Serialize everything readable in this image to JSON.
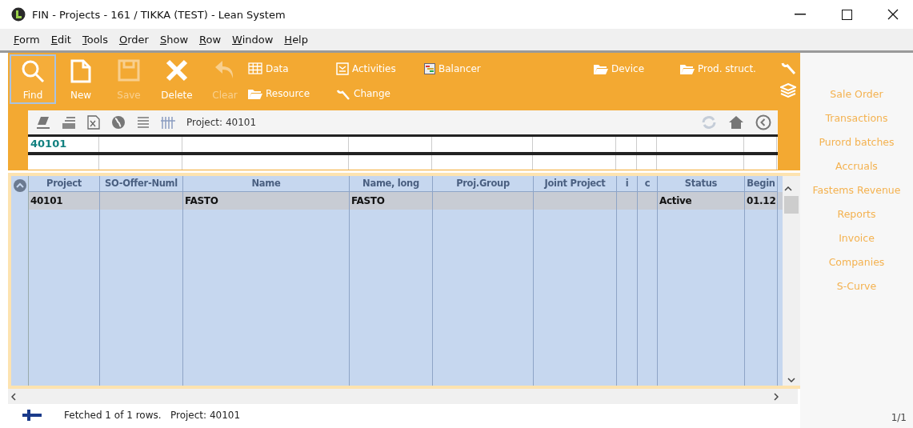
{
  "window": {
    "title": "FIN - Projects - 161 / TIKKA  (TEST)  - Lean System"
  },
  "menu": [
    "Form",
    "Edit",
    "Tools",
    "Order",
    "Show",
    "Row",
    "Window",
    "Help"
  ],
  "toolbar": {
    "buttons": [
      {
        "kind": "find",
        "label": "Find",
        "selected": true,
        "disabled": false
      },
      {
        "kind": "new",
        "label": "New",
        "selected": false,
        "disabled": false
      },
      {
        "kind": "save",
        "label": "Save",
        "selected": false,
        "disabled": true
      },
      {
        "kind": "delete",
        "label": "Delete",
        "selected": false,
        "disabled": false
      },
      {
        "kind": "clear",
        "label": "Clear",
        "selected": false,
        "disabled": true
      }
    ],
    "links_top": [
      {
        "kind": "grid",
        "label": "Data"
      },
      {
        "kind": "form",
        "label": "Activities"
      },
      {
        "kind": "chart",
        "label": "Balancer"
      },
      {
        "kind": "folder",
        "label": "Device"
      },
      {
        "kind": "folder",
        "label": "Prod. struct."
      }
    ],
    "links_bottom": [
      {
        "kind": "folder",
        "label": "Resource"
      },
      {
        "kind": "wrench",
        "label": "Change"
      }
    ]
  },
  "subtoolbar": {
    "caption": "Project: 40101"
  },
  "filter": {
    "value": "40101"
  },
  "table": {
    "columns": [
      "Project",
      "SO-Offer-Numl",
      "Name",
      "Name, long",
      "Proj.Group",
      "Joint Project",
      "i",
      "c",
      "Status",
      "Begin"
    ],
    "rows": [
      [
        "40101",
        "",
        "FASTO",
        "FASTO",
        "",
        "",
        "",
        "",
        "Active",
        "01.12"
      ]
    ]
  },
  "side_links": [
    "Sale Order",
    "Transactions",
    "Purord batches",
    "Accruals",
    "Fastems Revenue",
    "Reports",
    "Invoice",
    "Companies",
    "S-Curve"
  ],
  "status_bar": {
    "message": "Fetched 1 of 1 rows.   Project: 40101",
    "page": "1/1"
  }
}
